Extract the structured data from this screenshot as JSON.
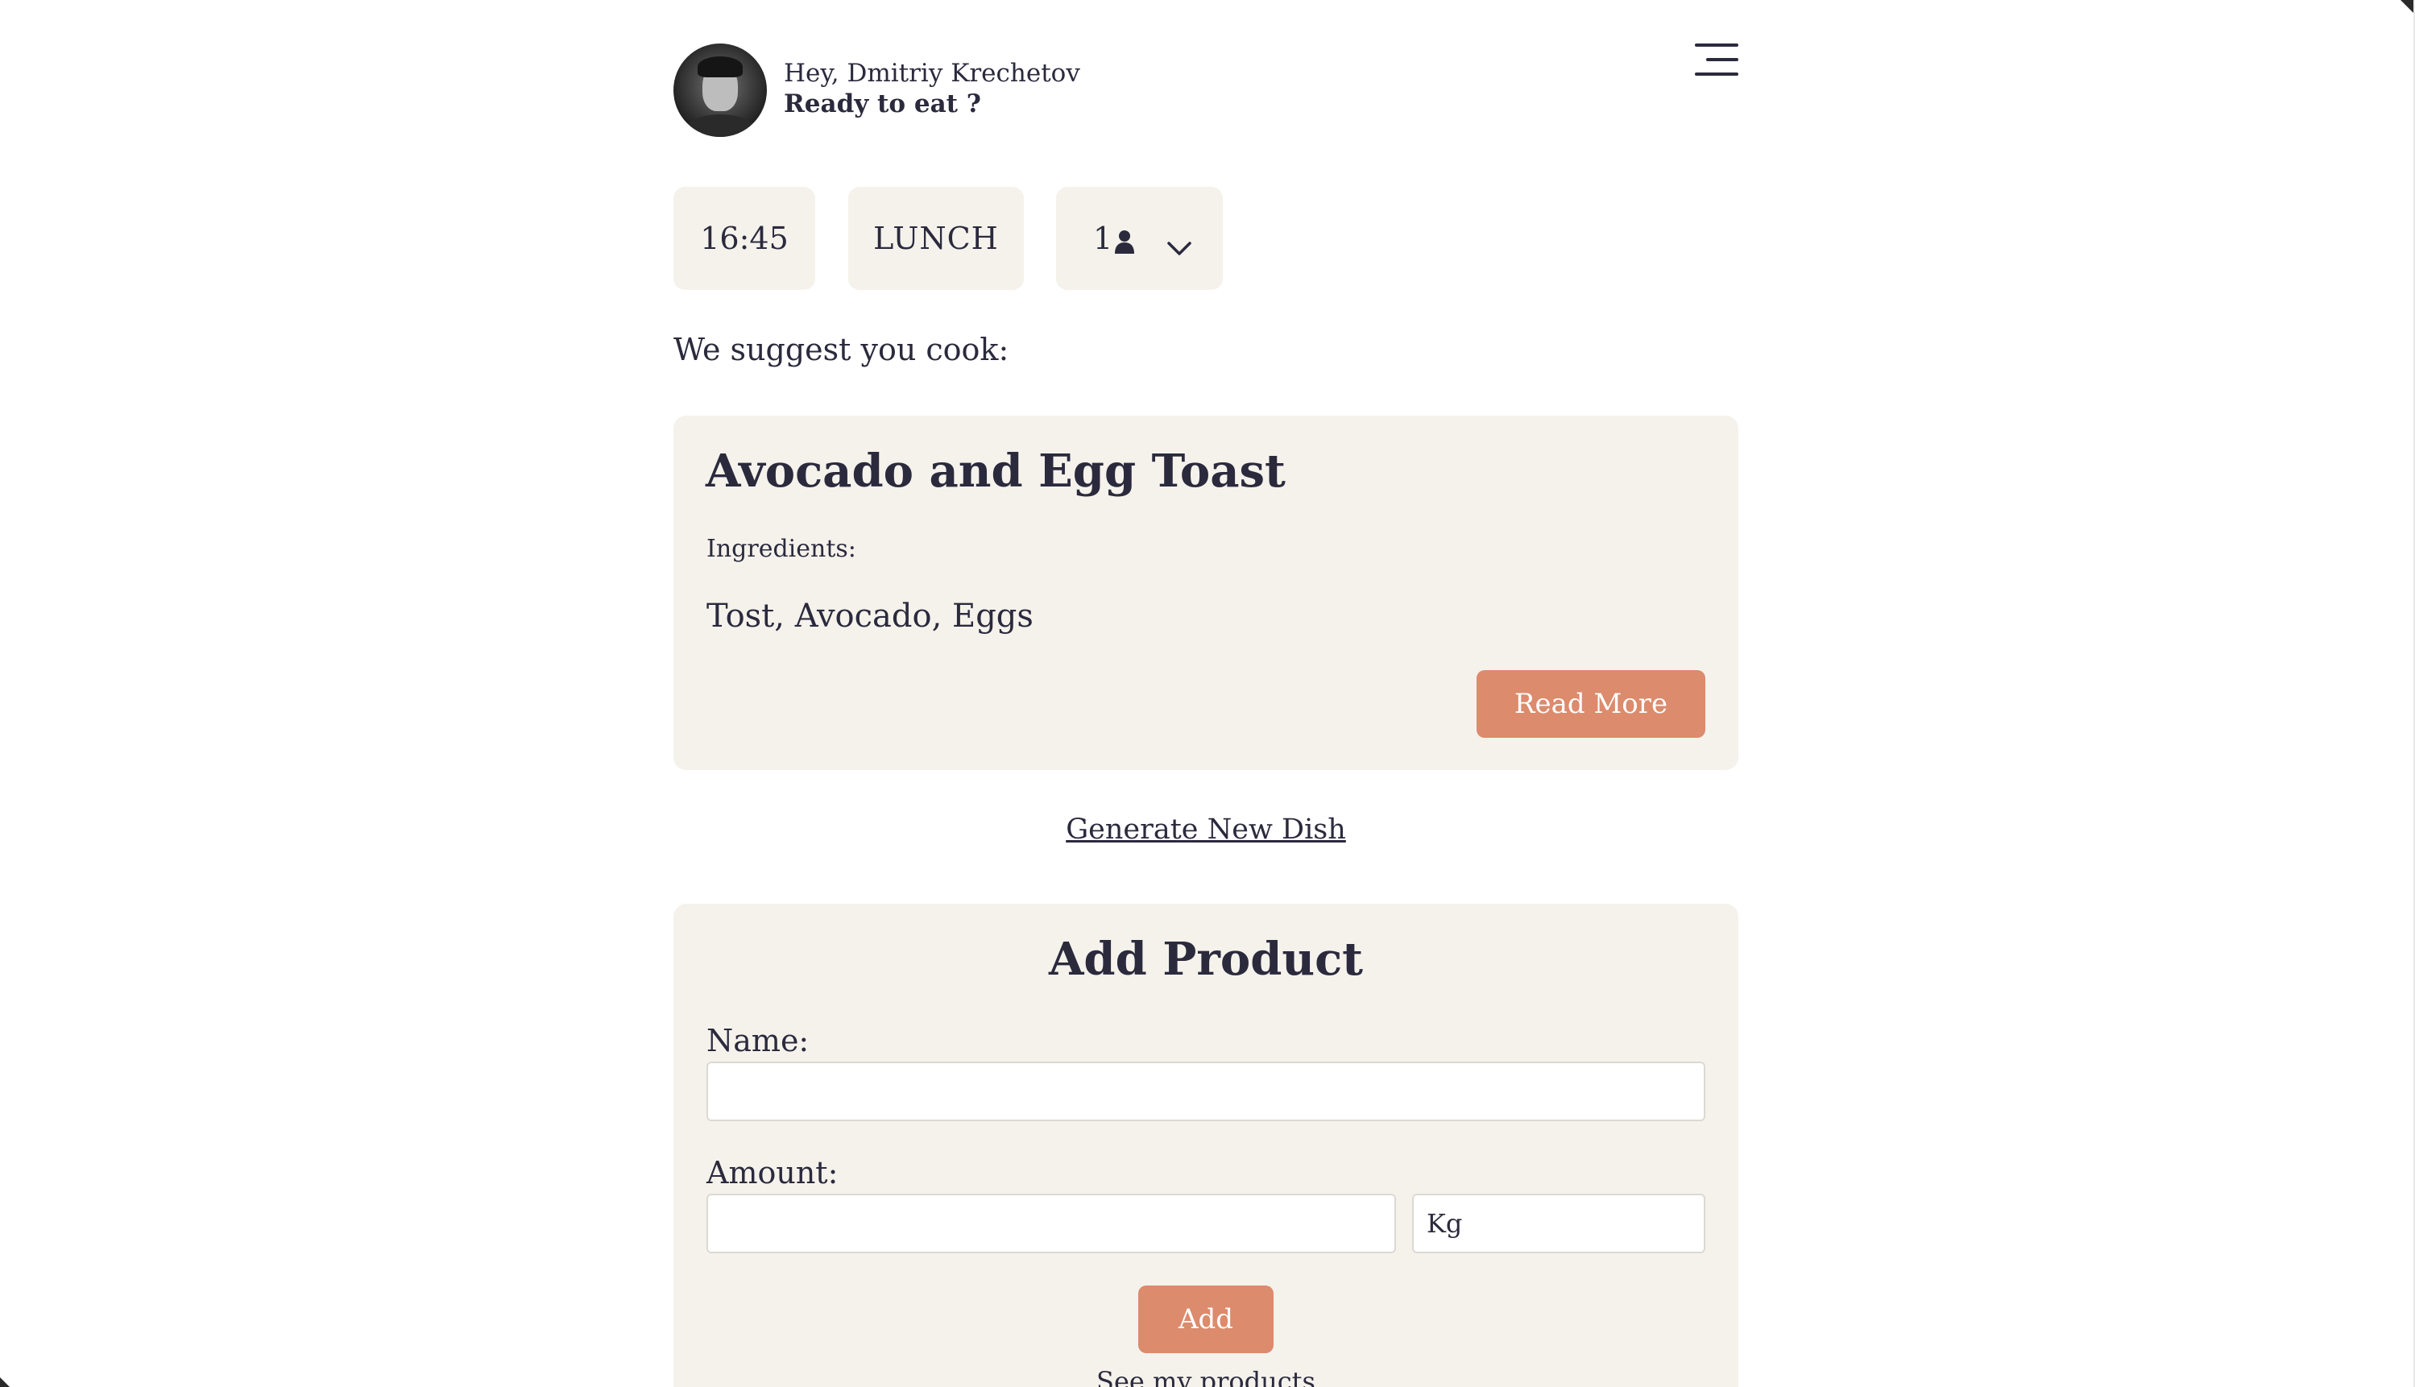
{
  "header": {
    "greeting": "Hey, Dmitriy Krechetov",
    "prompt": "Ready to eat ?"
  },
  "filters": {
    "time": "16:45",
    "meal": "LUNCH",
    "people": "1"
  },
  "suggest_label": "We suggest you cook:",
  "dish": {
    "title": "Avocado and Egg Toast",
    "ingredients_label": "Ingredients:",
    "ingredients": "Tost, Avocado, Eggs",
    "read_more": "Read More"
  },
  "generate_link": "Generate New Dish",
  "add_product": {
    "title": "Add Product",
    "name_label": "Name:",
    "name_value": "",
    "amount_label": "Amount:",
    "amount_value": "",
    "unit": "Kg",
    "add_button": "Add",
    "see_products": "See my products"
  },
  "colors": {
    "accent": "#dc8b6d",
    "card_bg": "#f5f2ec",
    "text": "#2b2a3d"
  },
  "icons": [
    "menu-icon",
    "person-icon",
    "chevron-down-icon"
  ]
}
